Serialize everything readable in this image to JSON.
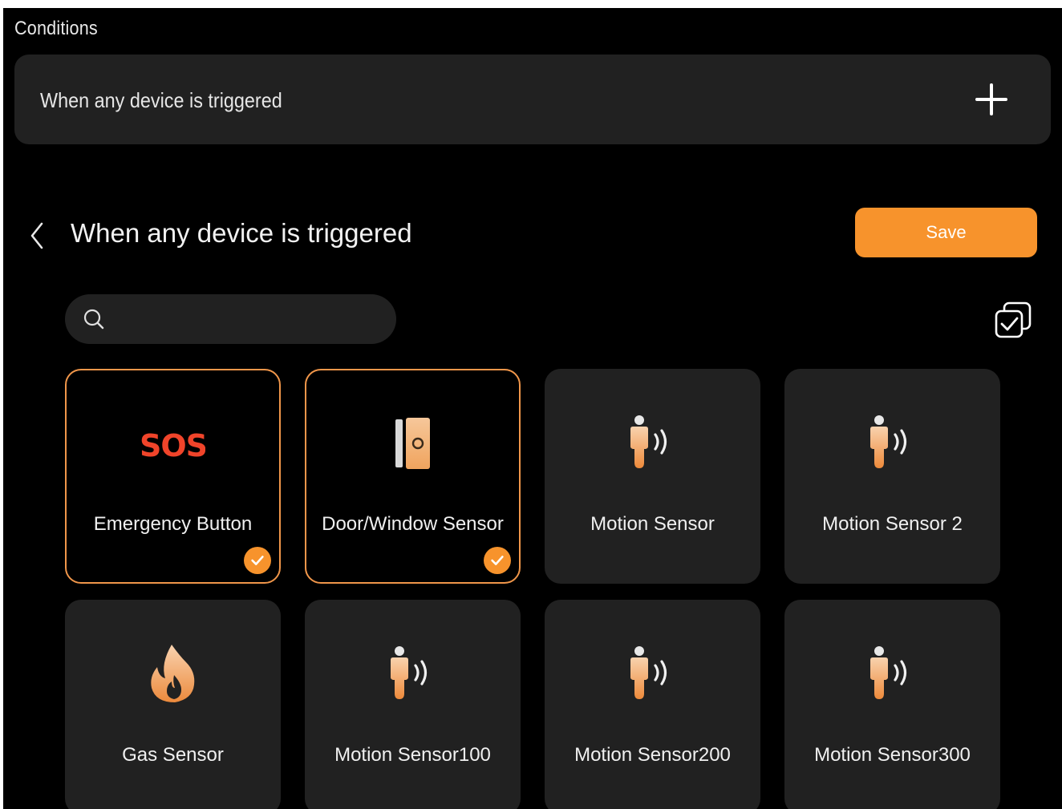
{
  "conditions": {
    "section_label": "Conditions",
    "row_text": "When any device is triggered",
    "add_icon": "plus-icon"
  },
  "header": {
    "back_icon": "chevron-left-icon",
    "title": "When any device is triggered",
    "save_label": "Save"
  },
  "search": {
    "icon": "search-icon",
    "placeholder": "",
    "value": ""
  },
  "select_all_icon": "select-all-checkbox-icon",
  "colors": {
    "accent": "#f7932c",
    "card_bg": "#212121",
    "background": "#000000",
    "selected_border": "#f0964a",
    "sos_red": "#f0442a"
  },
  "devices": [
    {
      "label": "Emergency Button",
      "icon": "sos-icon",
      "selected": true
    },
    {
      "label": "Door/Window Sensor",
      "icon": "door-sensor-icon",
      "selected": true
    },
    {
      "label": "Motion Sensor",
      "icon": "motion-sensor-icon",
      "selected": false
    },
    {
      "label": "Motion Sensor 2",
      "icon": "motion-sensor-icon",
      "selected": false
    },
    {
      "label": "Gas Sensor",
      "icon": "flame-icon",
      "selected": false
    },
    {
      "label": "Motion Sensor100",
      "icon": "motion-sensor-icon",
      "selected": false
    },
    {
      "label": "Motion Sensor200",
      "icon": "motion-sensor-icon",
      "selected": false
    },
    {
      "label": "Motion Sensor300",
      "icon": "motion-sensor-icon",
      "selected": false
    }
  ]
}
